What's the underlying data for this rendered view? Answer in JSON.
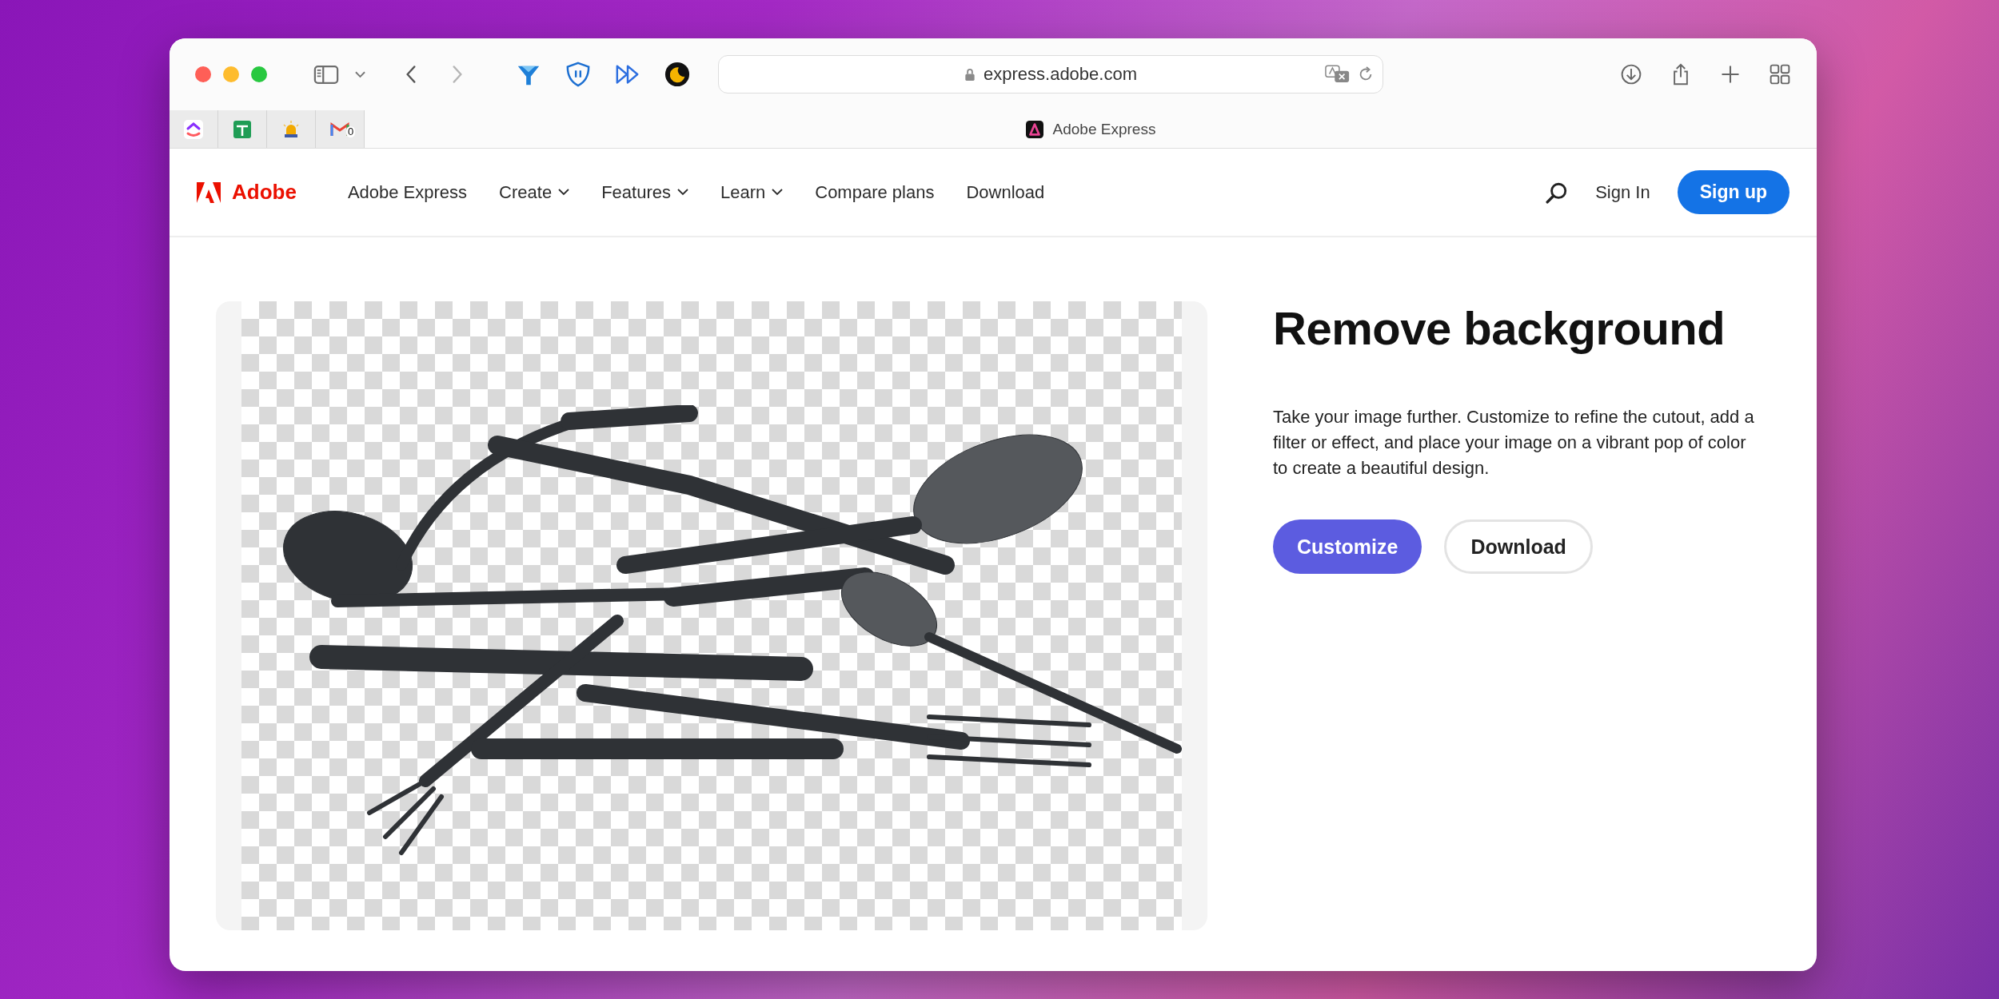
{
  "browser": {
    "address": "express.adobe.com",
    "pinned_tabs": [
      {
        "kind": "logo"
      },
      {
        "kind": "sheet"
      },
      {
        "kind": "lamp"
      },
      {
        "kind": "mail",
        "badge": "0"
      }
    ],
    "tab_title": "Adobe Express"
  },
  "nav": {
    "brand": "Adobe",
    "links": [
      {
        "label": "Adobe Express",
        "dropdown": false
      },
      {
        "label": "Create",
        "dropdown": true
      },
      {
        "label": "Features",
        "dropdown": true
      },
      {
        "label": "Learn",
        "dropdown": true
      },
      {
        "label": "Compare plans",
        "dropdown": false
      },
      {
        "label": "Download",
        "dropdown": false
      }
    ],
    "sign_in": "Sign In",
    "sign_up": "Sign up"
  },
  "hero": {
    "title": "Remove background",
    "description": "Take your image further. Customize to refine the cutout, add a filter or effect, and place your image on a vibrant pop of color to create a beautiful design.",
    "buttons": [
      {
        "label": "Customize",
        "kind": "primary"
      },
      {
        "label": "Download",
        "kind": "secondary"
      }
    ]
  }
}
